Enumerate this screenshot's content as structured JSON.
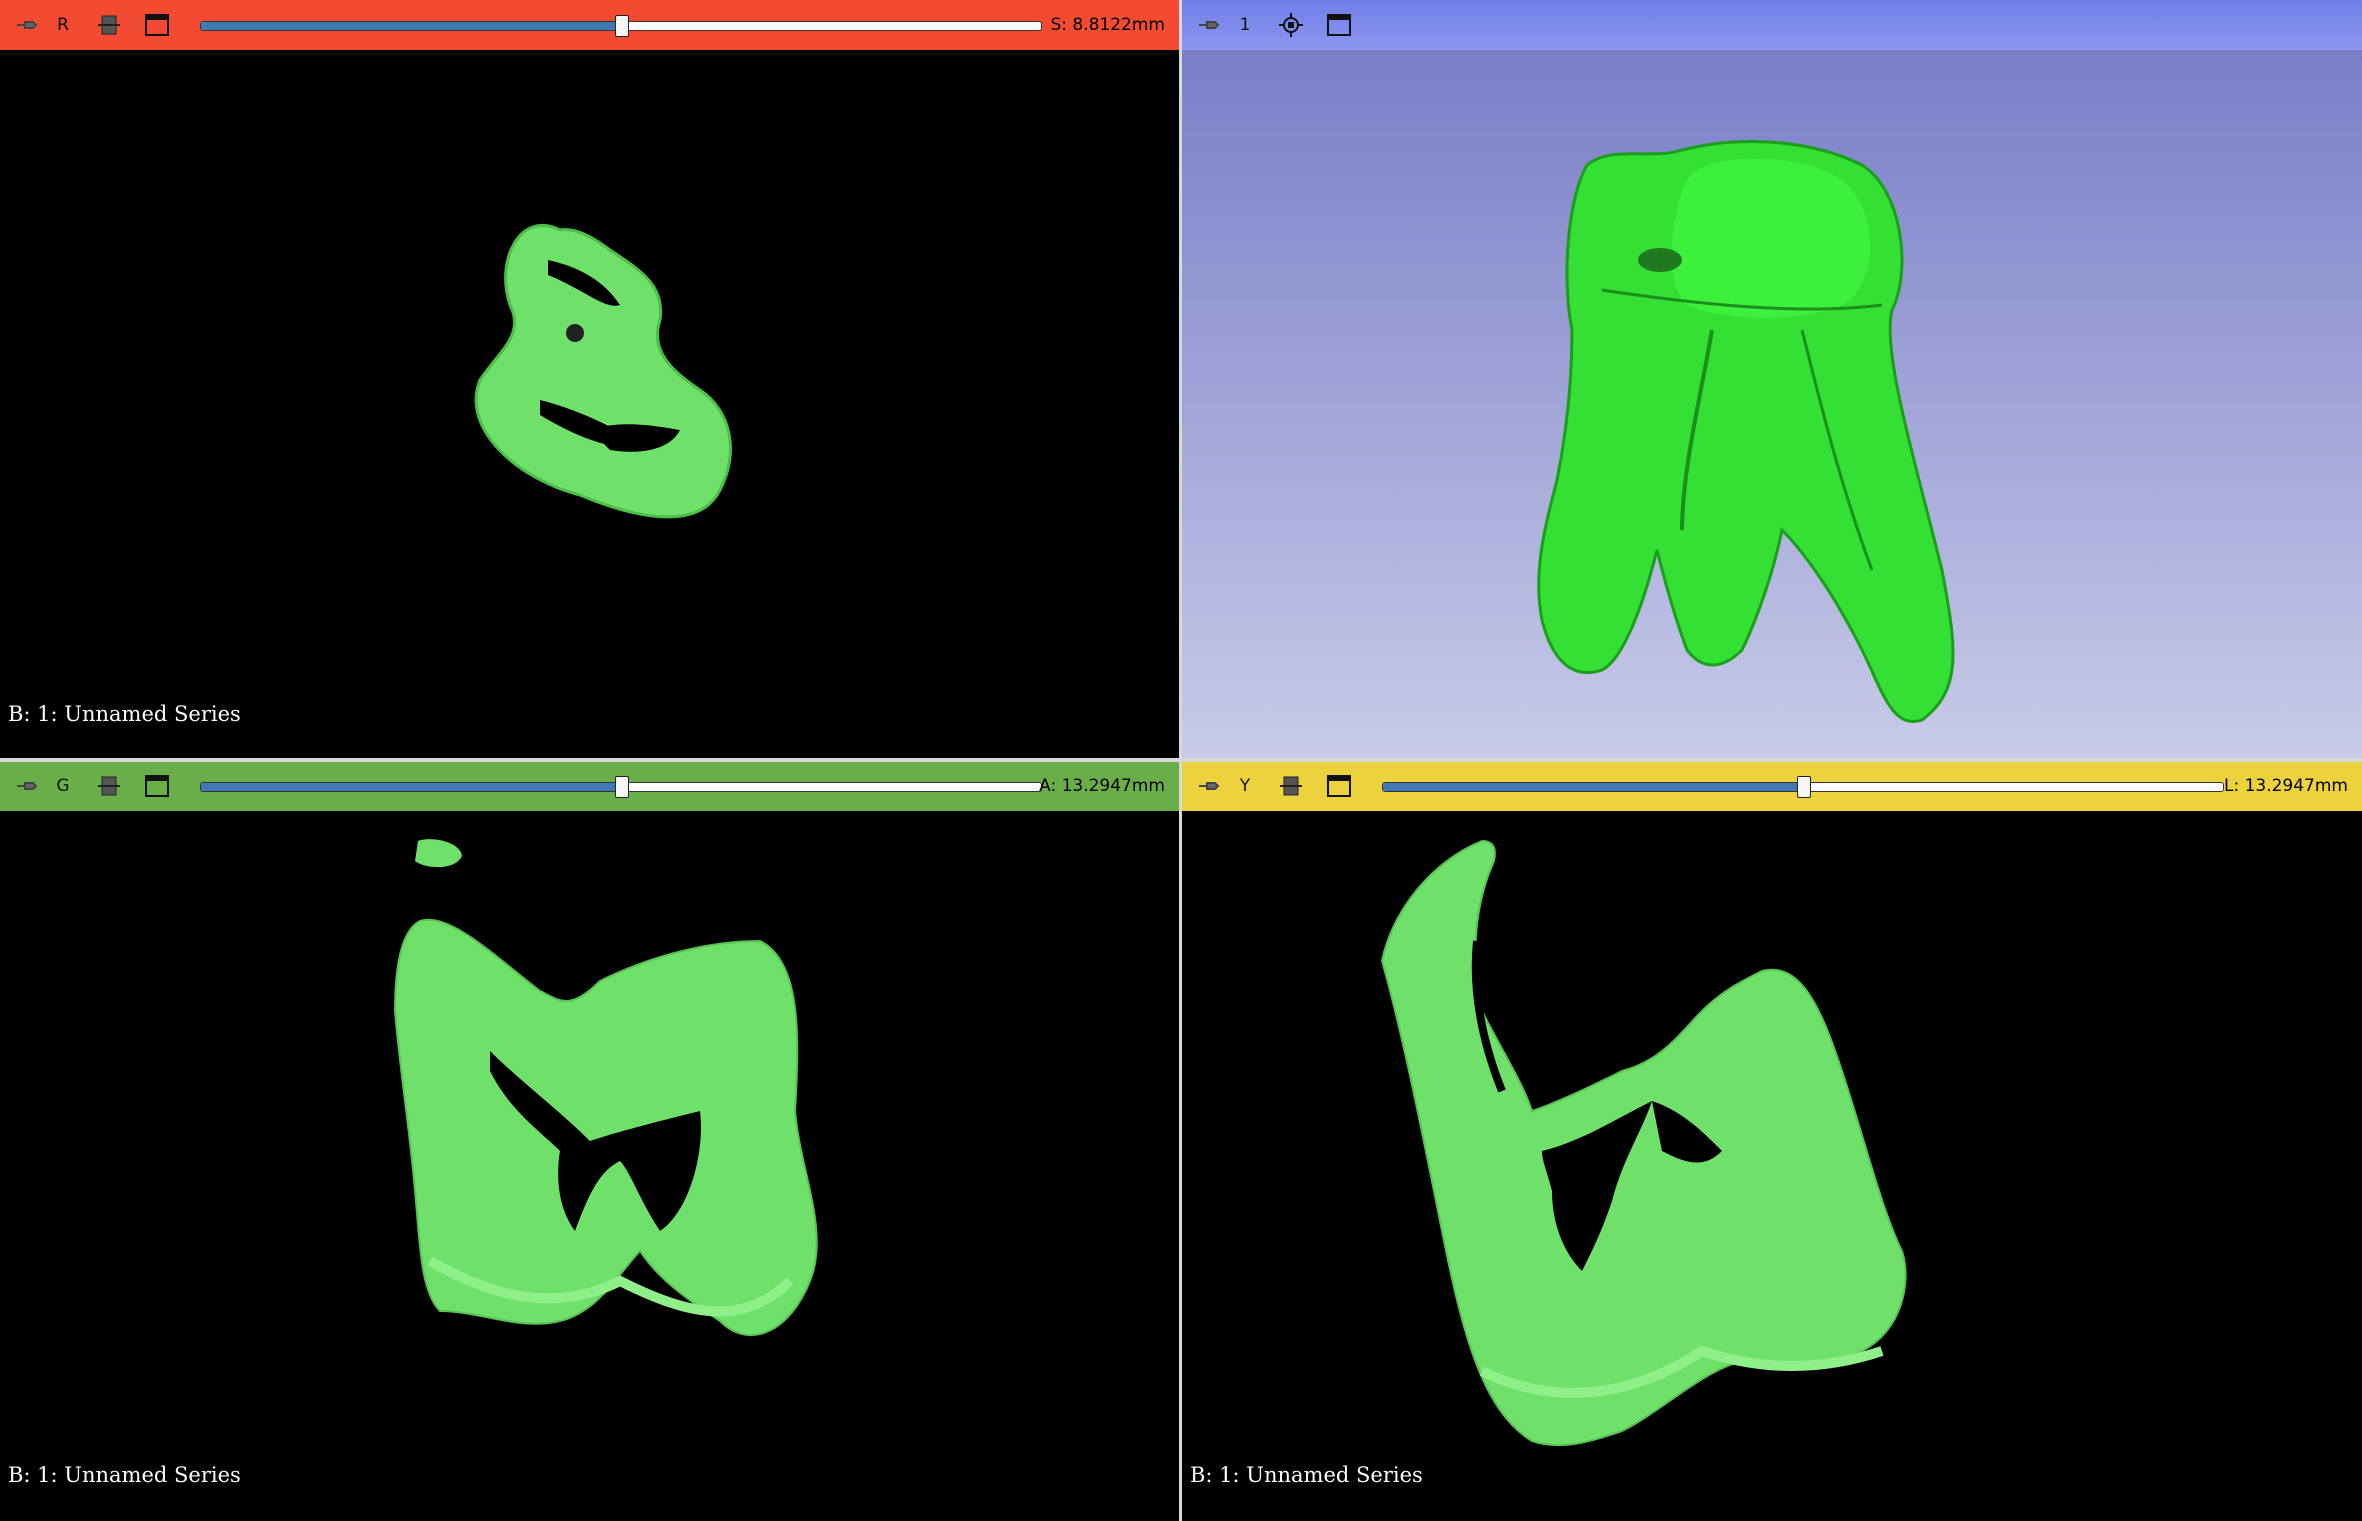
{
  "views": {
    "red": {
      "letter": "R",
      "slider_value": 0.5,
      "readout": "S: 8.8122mm",
      "series": "B: 1: Unnamed Series"
    },
    "threed": {
      "letter": "1"
    },
    "green": {
      "letter": "G",
      "slider_value": 0.5,
      "readout": "A: 13.2947mm",
      "series": "B: 1: Unnamed Series"
    },
    "yellow": {
      "letter": "Y",
      "slider_value": 0.5,
      "readout": "L: 13.2947mm",
      "series": "B: 1: Unnamed Series"
    }
  },
  "icons": {
    "pin": "pin-icon",
    "link": "link-icon",
    "center": "center-view-icon",
    "maximize": "maximize-view-icon"
  },
  "colors": {
    "red_bar": "#f34a32",
    "blue_bar": "#7a86ec",
    "green_bar": "#6aae49",
    "yellow_bar": "#ecd23c",
    "segment": "#6fe06a",
    "model": "#33e033"
  }
}
